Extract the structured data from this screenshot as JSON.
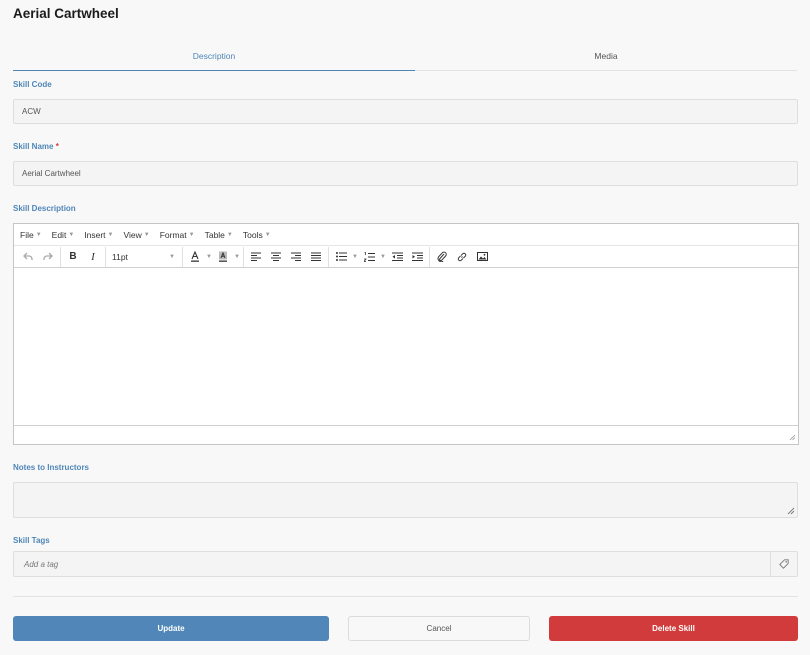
{
  "page": {
    "title": "Aerial Cartwheel"
  },
  "tabs": [
    {
      "label": "Description",
      "active": true
    },
    {
      "label": "Media",
      "active": false
    }
  ],
  "fields": {
    "skill_code": {
      "label": "Skill Code",
      "value": "ACW"
    },
    "skill_name": {
      "label": "Skill Name",
      "required_marker": "*",
      "value": "Aerial Cartwheel"
    },
    "skill_description": {
      "label": "Skill Description",
      "value": ""
    },
    "notes": {
      "label": "Notes to Instructors",
      "value": ""
    },
    "tags": {
      "label": "Skill Tags",
      "placeholder": "Add a tag"
    }
  },
  "editor": {
    "menus": [
      "File",
      "Edit",
      "Insert",
      "View",
      "Format",
      "Table",
      "Tools"
    ],
    "font_size": "11pt",
    "toolbar_icons": [
      "undo-icon",
      "redo-icon",
      "bold-icon",
      "italic-icon",
      "text-color-icon",
      "background-color-icon",
      "align-left-icon",
      "align-center-icon",
      "align-right-icon",
      "align-justify-icon",
      "bullet-list-icon",
      "numbered-list-icon",
      "outdent-icon",
      "indent-icon",
      "attachment-icon",
      "link-icon",
      "image-icon"
    ]
  },
  "buttons": {
    "update": "Update",
    "cancel": "Cancel",
    "delete": "Delete Skill"
  },
  "colors": {
    "accent": "#4f86b6",
    "primary_button": "#5186b8",
    "danger_button": "#d13b3b",
    "required": "#d9383a"
  }
}
